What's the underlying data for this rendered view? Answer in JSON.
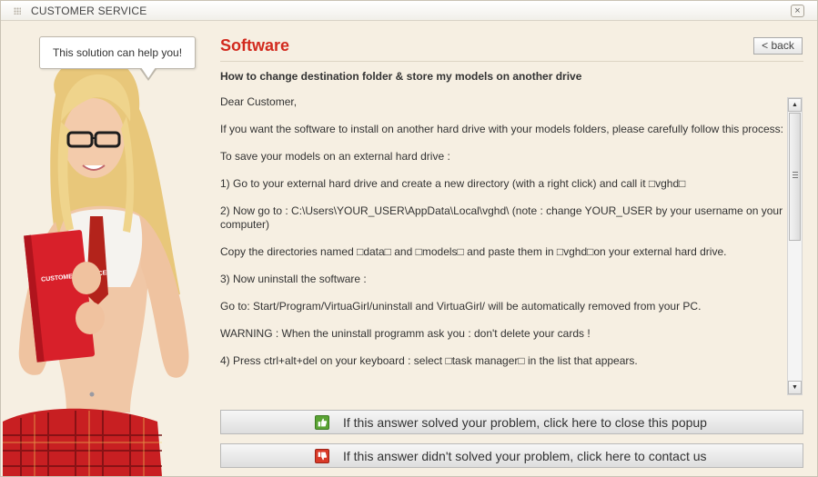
{
  "window": {
    "title": "CUSTOMER SERVICE",
    "close_glyph": "×"
  },
  "illustration": {
    "bubble_text": "This solution can help you!",
    "book_text": "CUSTOMER SERVICE"
  },
  "article": {
    "heading": "Software",
    "back_label": "< back",
    "subheading": "How to change destination folder & store my models on another drive",
    "paragraphs": [
      "Dear Customer,",
      "If you want the software to install on another hard drive with your models folders, please carefully follow this process:",
      "To save your models on an external hard drive :",
      "1) Go to your external hard drive and create a new directory (with a right click) and call it □vghd□",
      "2) Now go to : C:\\Users\\YOUR_USER\\AppData\\Local\\vghd\\ (note : change YOUR_USER by your username on your computer)",
      "Copy the directories named □data□ and □models□ and paste them in □vghd□on your external hard drive.",
      "3) Now uninstall the software :",
      "Go to: Start/Program/VirtuaGirl/uninstall and VirtuaGirl/ will be automatically removed from your PC.",
      "WARNING : When the uninstall programm ask you : don't delete your cards !",
      "4) Press ctrl+alt+del on your keyboard : select □task manager□ in the list that appears."
    ]
  },
  "scrollbar": {
    "up_glyph": "▲",
    "down_glyph": "▼"
  },
  "actions": {
    "solved_label": "If this answer solved your problem, click here to close this popup",
    "not_solved_label": "If this answer didn't solved your problem, click here to contact us",
    "solved_icon": "thumbs-up-icon",
    "not_solved_icon": "thumbs-down-icon"
  },
  "colors": {
    "heading": "#d22a1e",
    "panel_background": "#f6efe2",
    "thumbs_up": "#5aa334",
    "thumbs_down": "#d93a28"
  }
}
